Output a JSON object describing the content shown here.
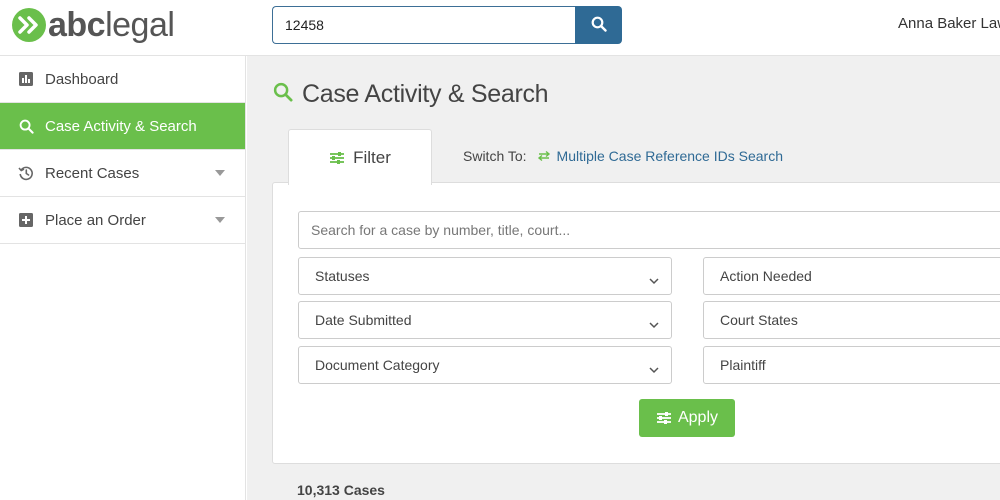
{
  "brand": {
    "abc": "abc",
    "legal": "legal"
  },
  "header": {
    "search_value": "12458",
    "user_name": "Anna Baker Law"
  },
  "sidebar": {
    "items": [
      {
        "label": "Dashboard"
      },
      {
        "label": "Case Activity & Search"
      },
      {
        "label": "Recent Cases"
      },
      {
        "label": "Place an Order"
      }
    ]
  },
  "main": {
    "title": "Case Activity & Search",
    "tab_filter": "Filter",
    "switch_to_label": "Switch To:",
    "switch_to_link": "Multiple Case Reference IDs Search",
    "case_search_placeholder": "Search for a case by number, title, court...",
    "filters": {
      "statuses": "Statuses",
      "date_submitted": "Date Submitted",
      "document_category": "Document Category",
      "action_needed": "Action Needed",
      "court_states": "Court States",
      "plaintiff": "Plaintiff"
    },
    "apply_label": "Apply",
    "case_count": "10,313 Cases"
  },
  "colors": {
    "brand_green": "#6abf4b",
    "primary_blue": "#2f6a95",
    "background": "#f0f0f0"
  },
  "icons": [
    "chevrons-right-icon",
    "search-icon",
    "bar-chart-icon",
    "history-icon",
    "plus-square-icon",
    "caret-down-icon",
    "sliders-icon",
    "swap-arrows-icon",
    "chevron-down-icon"
  ]
}
